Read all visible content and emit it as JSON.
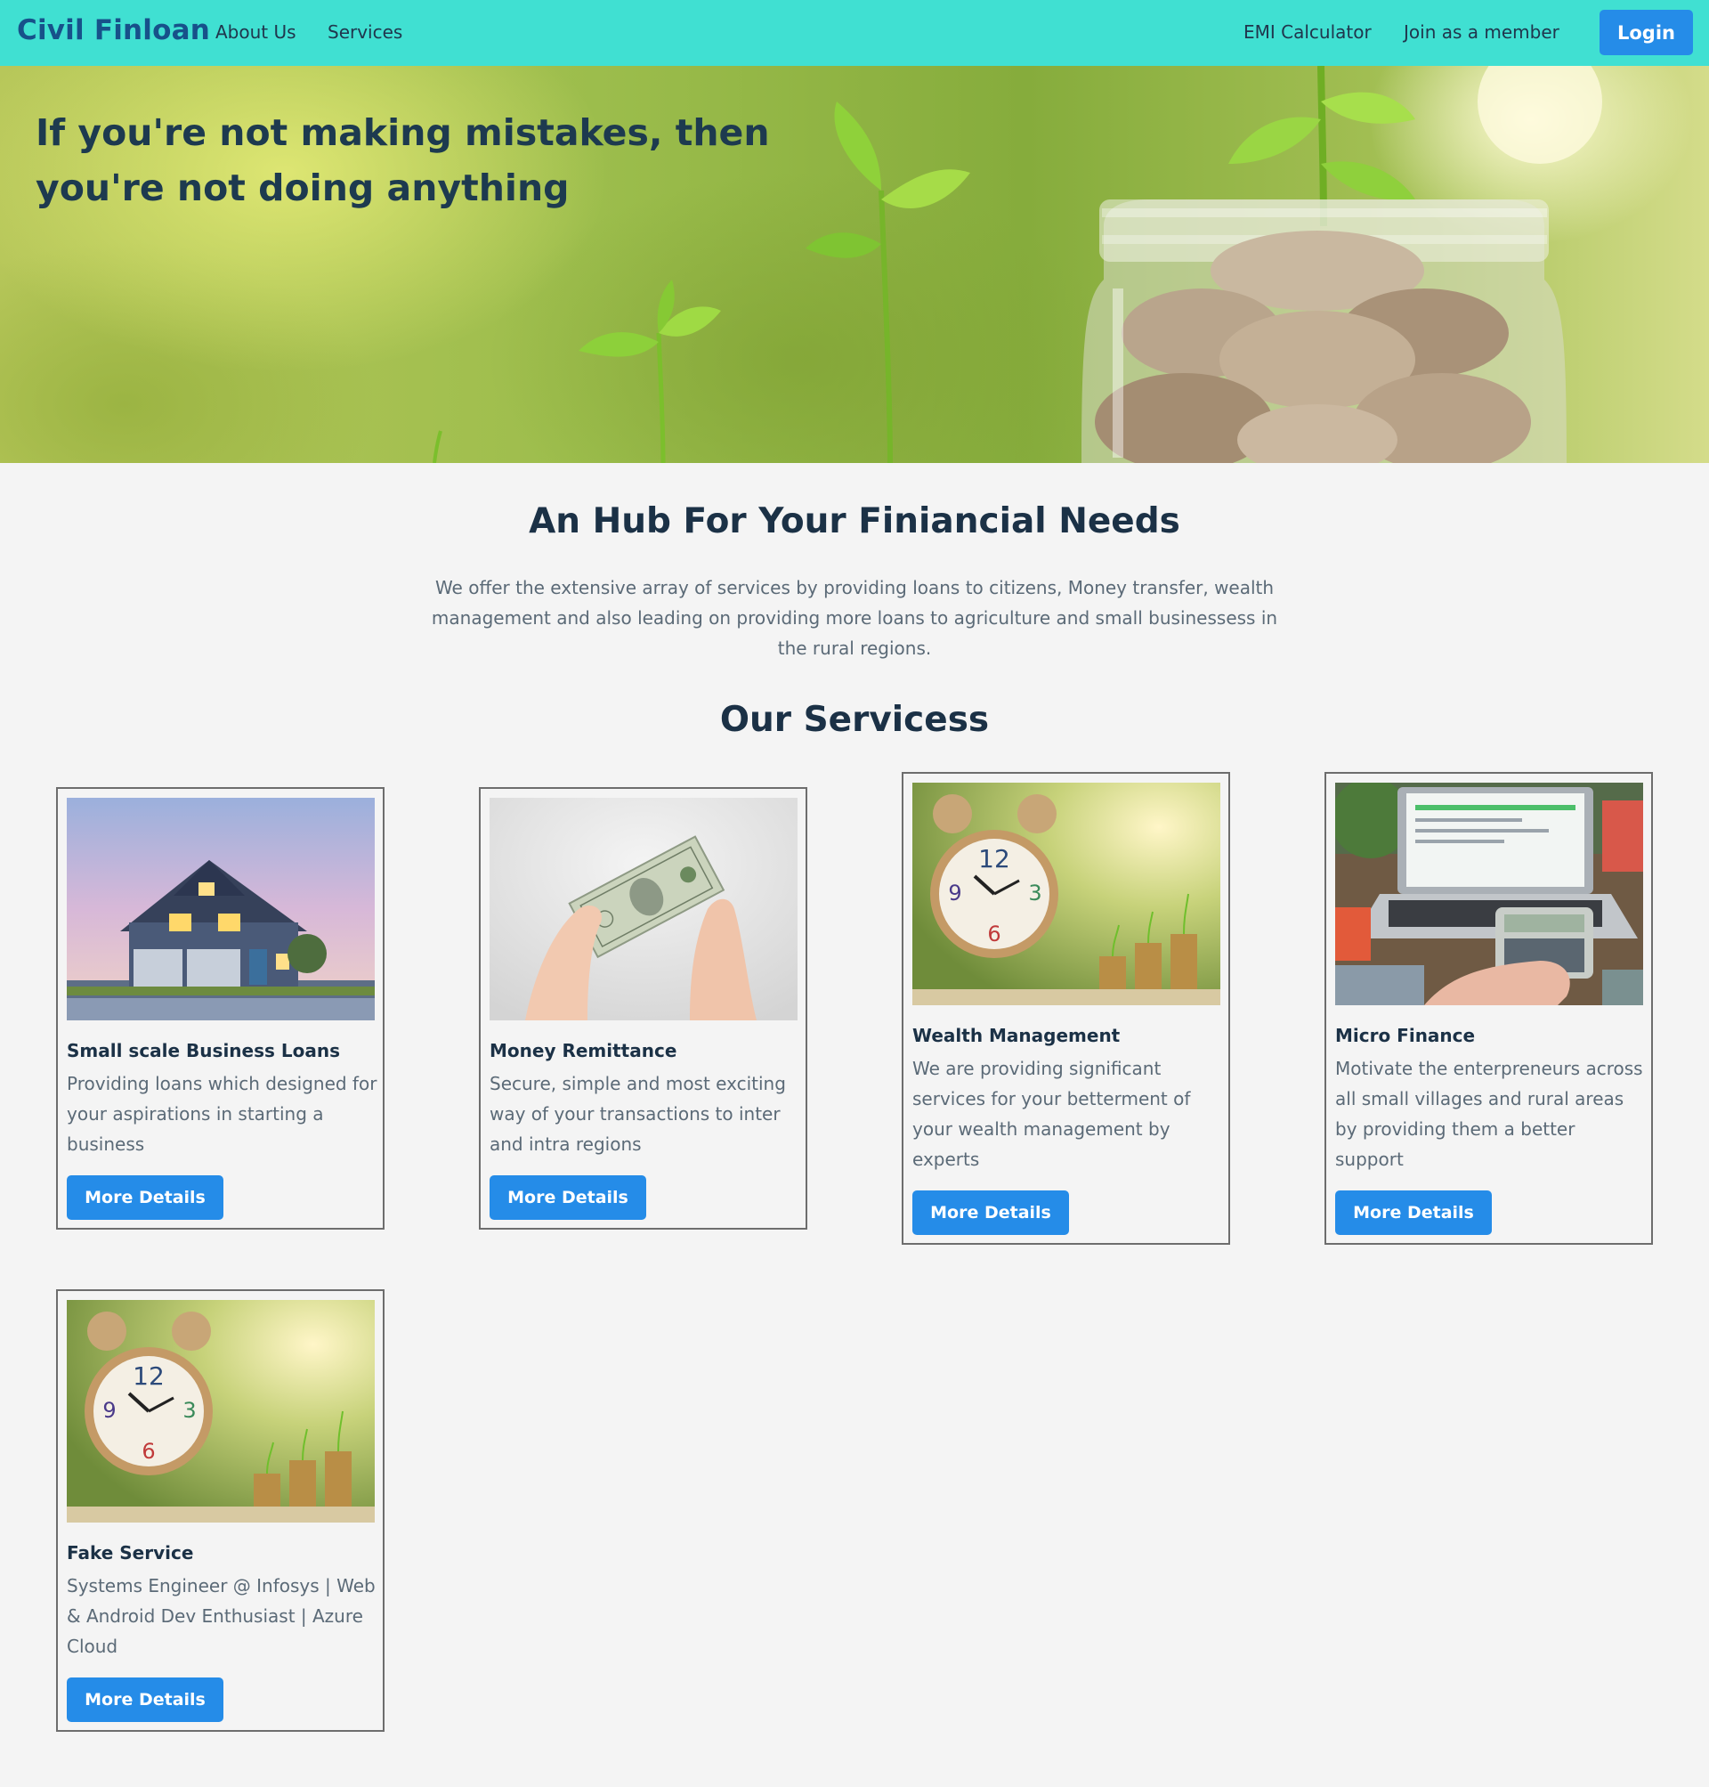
{
  "navbar": {
    "brand": "Civil Finloan",
    "links": [
      "About Us",
      "Services"
    ],
    "right_links": [
      "EMI Calculator",
      "Join as a member"
    ],
    "login_label": "Login",
    "color": "#40e0d2"
  },
  "hero": {
    "title": "If you're not making mistakes, then you're not doing anything"
  },
  "intro": {
    "title": "An Hub For Your Finiancial Needs",
    "text": "We offer the extensive array of services by providing loans to citizens, Money transfer, wealth management and also leading on providing more loans to agriculture and small businessess in the rural regions."
  },
  "services": {
    "title": "Our Servicess",
    "button_color": "#258ce8",
    "cards": [
      {
        "image": "house-photo",
        "title": "Small scale Business Loans",
        "description": "Providing loans which designed for your aspirations in starting a business",
        "button": "More Details"
      },
      {
        "image": "dollar-bill-photo",
        "title": "Money Remittance",
        "description": "Secure, simple and most exciting way of your transactions to inter and intra regions",
        "button": "More Details"
      },
      {
        "image": "alarm-clock-coins-photo",
        "title": "Wealth Management",
        "description": "We are providing significant services for your betterment of your wealth management by experts",
        "button": "More Details"
      },
      {
        "image": "laptop-calculator-photo",
        "title": "Micro Finance",
        "description": "Motivate the enterpreneurs across all small villages and rural areas by providing them a better support",
        "button": "More Details"
      },
      {
        "image": "alarm-clock-coins-photo",
        "title": "Fake Service",
        "description": "Systems Engineer @ Infosys | Web & Android Dev Enthusiast | Azure Cloud",
        "button": "More Details"
      }
    ]
  }
}
